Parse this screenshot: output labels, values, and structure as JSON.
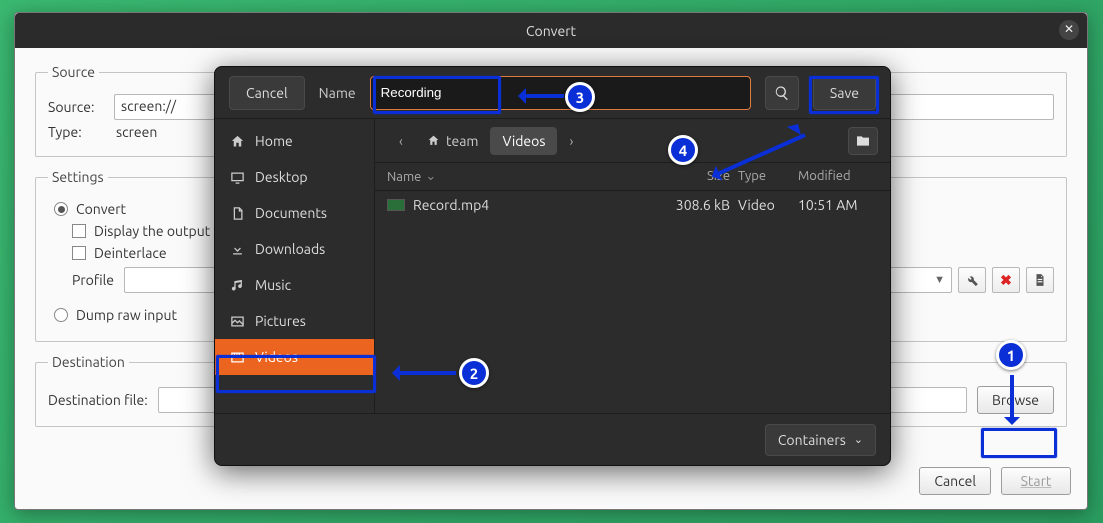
{
  "window": {
    "title": "Convert"
  },
  "source": {
    "legend": "Source",
    "source_label": "Source:",
    "source_value": "screen://",
    "type_label": "Type:",
    "type_value": "screen"
  },
  "settings": {
    "legend": "Settings",
    "convert": "Convert",
    "display_output": "Display the output",
    "deinterlace": "Deinterlace",
    "profile_label": "Profile",
    "dump_raw": "Dump raw input"
  },
  "destination": {
    "legend": "Destination",
    "file_label": "Destination file:",
    "browse": "Browse"
  },
  "footer": {
    "cancel": "Cancel",
    "start": "Start"
  },
  "dialog": {
    "cancel": "Cancel",
    "name_label": "Name",
    "name_value": "Recording",
    "save": "Save",
    "places": {
      "home": "Home",
      "desktop": "Desktop",
      "documents": "Documents",
      "downloads": "Downloads",
      "music": "Music",
      "pictures": "Pictures",
      "videos": "Videos"
    },
    "crumb_team": "team",
    "crumb_videos": "Videos",
    "cols": {
      "name": "Name",
      "size": "Size",
      "type": "Type",
      "modified": "Modified"
    },
    "file": {
      "name": "Record.mp4",
      "size": "308.6 kB",
      "type": "Video",
      "modified": "10:51 AM"
    },
    "filter": "Containers"
  },
  "annot": {
    "n1": "1",
    "n2": "2",
    "n3": "3",
    "n4": "4"
  }
}
